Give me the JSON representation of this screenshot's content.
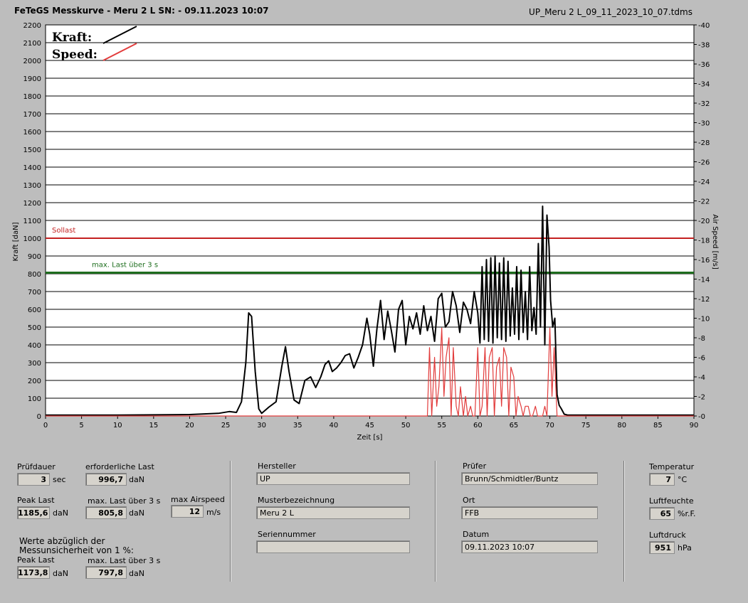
{
  "header": {
    "title": "FeTeGS Messkurve - Meru 2 L  SN:  - 09.11.2023 10:07",
    "filename": "UP_Meru 2 L_09_11_2023_10_07.tdms"
  },
  "colors": {
    "kraft": "#000000",
    "speed": "#e23c3c",
    "sollast": "#c42020",
    "max_last": "#1e6e1e",
    "plot_bg": "#ffffff",
    "window_bg": "#bdbdbd"
  },
  "chart_data": {
    "type": "line",
    "title": "",
    "xlabel": "Zeit [s]",
    "ylabel": "Kraft [daN]",
    "y2label": "Air Speed [m/s]",
    "xlim": [
      0,
      90
    ],
    "ylim": [
      0,
      2200
    ],
    "y2lim": [
      0,
      40
    ],
    "x_ticks": [
      0,
      5,
      10,
      15,
      20,
      25,
      30,
      35,
      40,
      45,
      50,
      55,
      60,
      65,
      70,
      75,
      80,
      85,
      90
    ],
    "y_ticks": [
      0,
      100,
      200,
      300,
      400,
      500,
      600,
      700,
      800,
      900,
      1000,
      1100,
      1200,
      1300,
      1400,
      1500,
      1600,
      1700,
      1800,
      1900,
      2000,
      2100,
      2200
    ],
    "y2_ticks": [
      0,
      2,
      4,
      6,
      8,
      10,
      12,
      14,
      16,
      18,
      20,
      22,
      24,
      26,
      28,
      30,
      32,
      34,
      36,
      38,
      40
    ],
    "grid": true,
    "legend": {
      "placement": "top-left",
      "entries": [
        "Kraft:",
        "Speed:"
      ]
    },
    "reference_lines": [
      {
        "label": "Sollast",
        "value": 1000
      },
      {
        "label": "max. Last über  3 s",
        "value": 805.8
      }
    ],
    "series": [
      {
        "name": "Kraft:",
        "axis": "left",
        "x": [
          0,
          10,
          20,
          24,
          25.5,
          26.5,
          27.2,
          27.8,
          28.2,
          28.6,
          29.1,
          29.6,
          30,
          31,
          32,
          32.8,
          33.3,
          33.8,
          34.5,
          35.2,
          36,
          36.8,
          37.5,
          38.2,
          38.8,
          39.3,
          39.8,
          40.4,
          41,
          41.6,
          42.2,
          42.8,
          43.4,
          44,
          44.6,
          45,
          45.5,
          46,
          46.5,
          47,
          47.5,
          48,
          48.5,
          49,
          49.5,
          50,
          50.5,
          51,
          51.5,
          52,
          52.5,
          53,
          53.5,
          54,
          54.5,
          55,
          55.5,
          56,
          56.5,
          57,
          57.5,
          58,
          58.5,
          59,
          59.5,
          60,
          60.3,
          60.6,
          60.9,
          61.2,
          61.5,
          61.8,
          62.1,
          62.4,
          62.7,
          63,
          63.3,
          63.6,
          63.9,
          64.2,
          64.5,
          64.8,
          65.1,
          65.4,
          65.7,
          66,
          66.3,
          66.6,
          66.9,
          67.2,
          67.5,
          67.8,
          68.1,
          68.4,
          68.7,
          69,
          69.3,
          69.6,
          69.9,
          70.1,
          70.4,
          70.7,
          71,
          71.3,
          71.6,
          72,
          72.5,
          80,
          90
        ],
        "values": [
          5,
          5,
          8,
          15,
          25,
          20,
          80,
          300,
          580,
          560,
          250,
          40,
          15,
          50,
          80,
          280,
          390,
          250,
          90,
          70,
          200,
          220,
          160,
          220,
          290,
          310,
          250,
          270,
          300,
          340,
          350,
          270,
          330,
          400,
          550,
          460,
          280,
          490,
          650,
          430,
          590,
          480,
          360,
          600,
          650,
          400,
          560,
          490,
          580,
          460,
          620,
          480,
          560,
          420,
          660,
          690,
          500,
          530,
          700,
          620,
          470,
          640,
          600,
          520,
          700,
          580,
          410,
          840,
          430,
          880,
          420,
          890,
          410,
          900,
          440,
          860,
          430,
          890,
          420,
          870,
          450,
          720,
          460,
          840,
          430,
          820,
          470,
          700,
          430,
          840,
          480,
          610,
          460,
          970,
          500,
          1180,
          400,
          1130,
          950,
          650,
          500,
          550,
          120,
          60,
          40,
          10,
          5,
          5,
          5
        ]
      },
      {
        "name": "Speed:",
        "axis": "right",
        "x": [
          0,
          53,
          53.3,
          53.6,
          54,
          54.3,
          54.6,
          55,
          55.3,
          55.6,
          56,
          56.3,
          56.6,
          57,
          57.3,
          57.6,
          58,
          58.3,
          58.6,
          59,
          59.3,
          59.6,
          60,
          60.3,
          60.6,
          61,
          61.3,
          61.6,
          62,
          62.3,
          62.6,
          63,
          63.3,
          63.6,
          64,
          64.3,
          64.6,
          65,
          65.3,
          65.6,
          66,
          66.3,
          66.6,
          67,
          67.3,
          67.6,
          68,
          68.3,
          68.6,
          69,
          69.3,
          69.6,
          70,
          70.3,
          70.6,
          71,
          90
        ],
        "values": [
          0,
          0,
          7,
          0,
          6,
          1,
          3,
          9,
          2,
          6,
          8,
          0,
          7,
          1,
          0,
          3,
          0,
          2,
          0,
          1,
          0,
          0,
          7,
          0,
          1,
          7,
          0,
          6,
          7,
          0,
          5,
          6,
          1,
          7,
          6,
          0,
          5,
          4,
          0,
          2,
          1,
          0,
          1,
          1,
          0,
          0,
          1,
          0,
          0,
          0,
          1,
          0,
          9,
          2,
          7,
          0,
          0
        ]
      }
    ]
  },
  "panel": {
    "pruefdauer": {
      "label": "Prüfdauer",
      "value": "3",
      "unit": "sec"
    },
    "erf_last": {
      "label": "erforderliche Last",
      "value": "996,7",
      "unit": "daN"
    },
    "peak_last": {
      "label": "Peak Last",
      "value": "1185,6",
      "unit": "daN"
    },
    "max_last": {
      "label": "max. Last über  3 s",
      "value": "805,8",
      "unit": "daN"
    },
    "max_airspeed": {
      "label": "max Airspeed",
      "value": "12",
      "unit": "m/s"
    },
    "werte_note_1": "Werte abzüglich der",
    "werte_note_2": "Messunsicherheit von 1  %:",
    "peak_last_corr": {
      "label": "Peak Last",
      "value": "1173,8",
      "unit": "daN"
    },
    "max_last_corr": {
      "label": "max. Last über  3 s",
      "value": "797,8",
      "unit": "daN"
    },
    "hersteller": {
      "label": "Hersteller",
      "value": "UP"
    },
    "musterbezeichnung": {
      "label": "Musterbezeichnung",
      "value": "Meru 2 L"
    },
    "seriennummer": {
      "label": "Seriennummer",
      "value": ""
    },
    "pruefer": {
      "label": "Prüfer",
      "value": "Brunn/Schmidtler/Buntz"
    },
    "ort": {
      "label": "Ort",
      "value": "FFB"
    },
    "datum": {
      "label": "Datum",
      "value": "09.11.2023 10:07"
    },
    "temperatur": {
      "label": "Temperatur",
      "value": "7",
      "unit": "°C"
    },
    "luftfeuchte": {
      "label": "Luftfeuchte",
      "value": "65",
      "unit": "%r.F."
    },
    "luftdruck": {
      "label": "Luftdruck",
      "value": "951",
      "unit": "hPa"
    }
  }
}
